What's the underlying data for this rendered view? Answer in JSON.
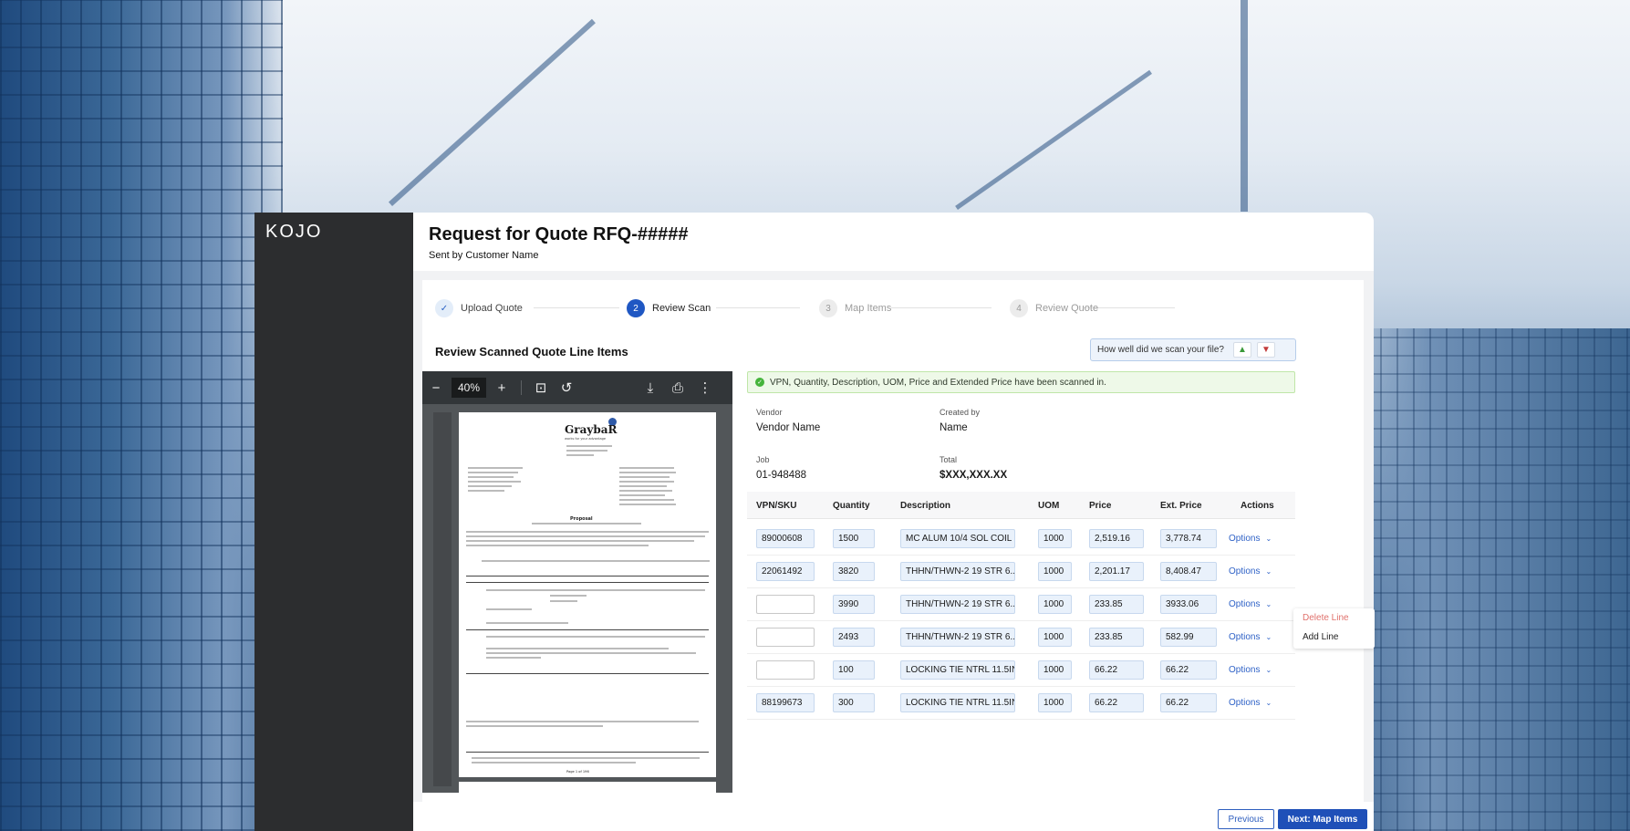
{
  "app": {
    "logo": "KOJO"
  },
  "header": {
    "title": "Request for Quote RFQ-#####",
    "subtitle": "Sent by Customer Name"
  },
  "steps": [
    {
      "num": "✓",
      "label": "Upload Quote",
      "state": "done"
    },
    {
      "num": "2",
      "label": "Review Scan",
      "state": "active"
    },
    {
      "num": "3",
      "label": "Map Items",
      "state": "todo"
    },
    {
      "num": "4",
      "label": "Review Quote",
      "state": "todo"
    }
  ],
  "section_title": "Review Scanned Quote Line Items",
  "feedback": {
    "text": "How well did we scan your file?",
    "up_icon": "thumbs-up-icon",
    "down_icon": "thumbs-down-icon"
  },
  "pdf_viewer": {
    "zoom": "40%",
    "page": {
      "logo": "GraybaR",
      "tagline": "works for your advantage",
      "proposal": "Proposal",
      "footer": "Page 1 of 196"
    }
  },
  "notice": "VPN, Quantity, Description, UOM, Price and Extended Price have been scanned in.",
  "meta": {
    "vendor_label": "Vendor",
    "vendor_value": "Vendor Name",
    "created_label": "Created by",
    "created_value": "Name",
    "job_label": "Job",
    "job_value": "01-948488",
    "total_label": "Total",
    "total_value": "$XXX,XXX.XX"
  },
  "table": {
    "headers": [
      "VPN/SKU",
      "Quantity",
      "Description",
      "UOM",
      "Price",
      "Ext. Price",
      "Actions"
    ],
    "rows": [
      {
        "sku": "89000608",
        "qty": "1500",
        "desc": "MC ALUM 10/4 SOL COIL",
        "uom": "1000",
        "price": "2,519.16",
        "ext": "3,778.74",
        "action": "Options"
      },
      {
        "sku": "22061492",
        "qty": "3820",
        "desc": "THHN/THWN-2 19 STR 6...",
        "uom": "1000",
        "price": "2,201.17",
        "ext": "8,408.47",
        "action": "Options"
      },
      {
        "sku": "",
        "qty": "3990",
        "desc": "THHN/THWN-2 19 STR 6...",
        "uom": "1000",
        "price": "233.85",
        "ext": "3933.06",
        "action": "Options"
      },
      {
        "sku": "",
        "qty": "2493",
        "desc": "THHN/THWN-2 19 STR 6...",
        "uom": "1000",
        "price": "233.85",
        "ext": "582.99",
        "action": "Options"
      },
      {
        "sku": "",
        "qty": "100",
        "desc": "LOCKING TIE NTRL 11.5IN",
        "uom": "1000",
        "price": "66.22",
        "ext": "66.22",
        "action": "Options"
      },
      {
        "sku": "88199673",
        "qty": "300",
        "desc": "LOCKING TIE NTRL 11.5IN",
        "uom": "1000",
        "price": "66.22",
        "ext": "66.22",
        "action": "Options"
      }
    ]
  },
  "row_menu": {
    "delete": "Delete Line",
    "add": "Add Line"
  },
  "footer": {
    "previous": "Previous",
    "next": "Next: Map Items"
  },
  "colors": {
    "primary": "#1f50b8",
    "sidebar": "#2c2d2f",
    "success": "#45b43b",
    "danger": "#e0716c"
  }
}
